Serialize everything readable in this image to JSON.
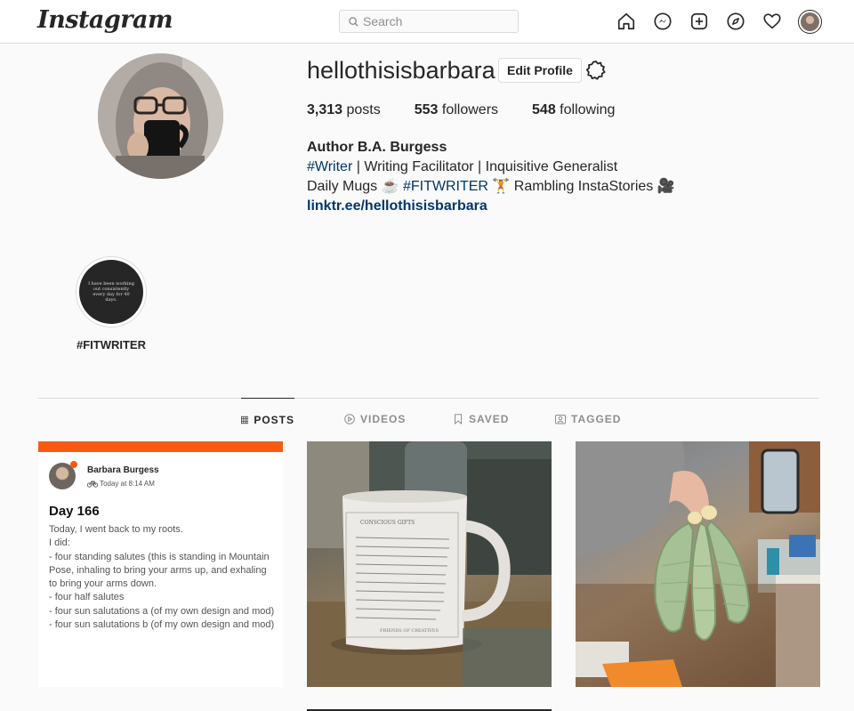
{
  "nav": {
    "logo": "Instagram",
    "search_placeholder": "Search",
    "icons": [
      "home-icon",
      "messenger-icon",
      "new-post-icon",
      "explore-icon",
      "activity-heart-icon",
      "profile-avatar"
    ]
  },
  "profile": {
    "username": "hellothisisbarbara",
    "edit_label": "Edit Profile",
    "stats": {
      "posts_count": "3,313",
      "posts_label": " posts",
      "followers_count": "553",
      "followers_label": " followers",
      "following_count": "548",
      "following_label": " following"
    },
    "bio": {
      "name": "Author B.A. Burgess",
      "line1_tag": "#Writer",
      "line1_rest": " | Writing Facilitator | Inquisitive Generalist",
      "line2_a": "Daily Mugs ☕ ",
      "line2_tag": "#FITWRITER",
      "line2_b": " 🏋 Rambling InstaStories 🎥",
      "link": "linktr.ee/hellothisisbarbara"
    }
  },
  "highlight": {
    "label": "#FITWRITER",
    "cover_text": "I have been working out consistently every day for 40 days."
  },
  "tabs": {
    "posts": "POSTS",
    "videos": "VIDEOS",
    "saved": "SAVED",
    "tagged": "TAGGED"
  },
  "post1": {
    "author": "Barbara Burgess",
    "time": "Today at 8:14 AM",
    "title": "Day 166",
    "body": "Today, I went back to my roots.\nI did:\n- four standing salutes (this is standing in Mountain Pose, inhaling to bring your arms up, and exhaling to bring your arms down.\n- four half salutes\n- four sun salutations a (of my own design and mod)\n- four sun salutations b (of my own design and mod)"
  },
  "post2": {
    "mug_heading": "CONSCIOUS GIFTS",
    "mug_footer": "FRIENDS OF CREATIVES"
  },
  "colors": {
    "accent_orange": "#f65b16",
    "link_blue": "#00376b",
    "border": "#dbdbdb",
    "text": "#262626"
  }
}
